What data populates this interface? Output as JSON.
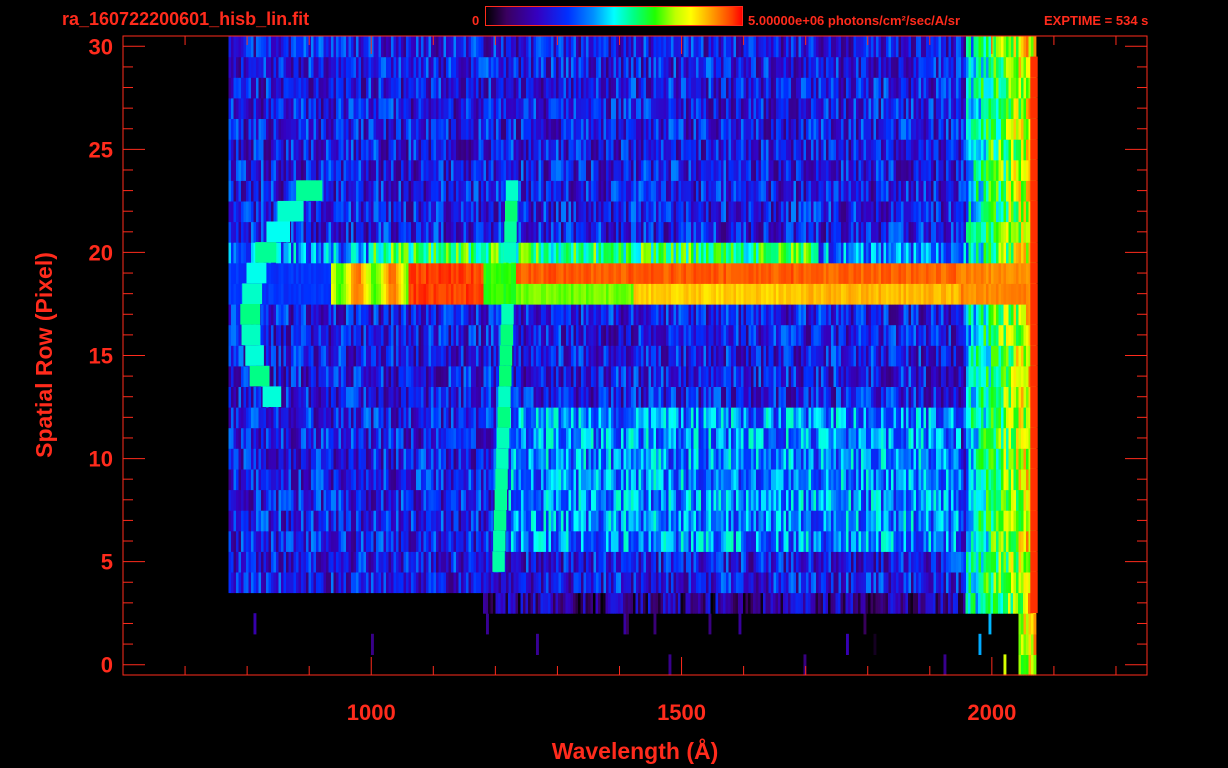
{
  "header": {
    "file_title": "ra_160722200601_hisb_lin.fit",
    "colorbar_min": "0",
    "colorbar_max": "5.00000e+06 photons/cm²/sec/A/sr",
    "exptime": "EXPTIME = 534 s"
  },
  "colors": {
    "background": "#000000",
    "axis": "#ff2b1c"
  },
  "chart_data": {
    "type": "heatmap",
    "title": "ra_160722200601_hisb_lin.fit",
    "xlabel": "Wavelength (Å)",
    "ylabel": "Spatial Row (Pixel)",
    "xlim": [
      600,
      2250
    ],
    "ylim": [
      -0.5,
      30.5
    ],
    "x_ticks": [
      {
        "value": 1000,
        "label": "1000"
      },
      {
        "value": 1500,
        "label": "1500"
      },
      {
        "value": 2000,
        "label": "2000"
      }
    ],
    "y_ticks": [
      {
        "value": 0,
        "label": "0"
      },
      {
        "value": 5,
        "label": "5"
      },
      {
        "value": 10,
        "label": "10"
      },
      {
        "value": 15,
        "label": "15"
      },
      {
        "value": 20,
        "label": "20"
      },
      {
        "value": 25,
        "label": "25"
      },
      {
        "value": 30,
        "label": "30"
      }
    ],
    "colorbar": {
      "min": 0,
      "max": 5000000,
      "unit": "photons/cm²/sec/A/sr",
      "scale": "linear",
      "colormap": "rainbow"
    },
    "data_extent_wavelength": [
      770,
      2070
    ],
    "features": [
      {
        "name": "bright band",
        "wavelength_range": [
          935,
          2075
        ],
        "rows": [
          18,
          19
        ]
      },
      {
        "name": "vertical line",
        "wavelength": 1216,
        "rows": [
          5,
          23
        ]
      },
      {
        "name": "curved arc",
        "wavelength_range": [
          800,
          940
        ],
        "rows": [
          13,
          23
        ]
      }
    ]
  }
}
